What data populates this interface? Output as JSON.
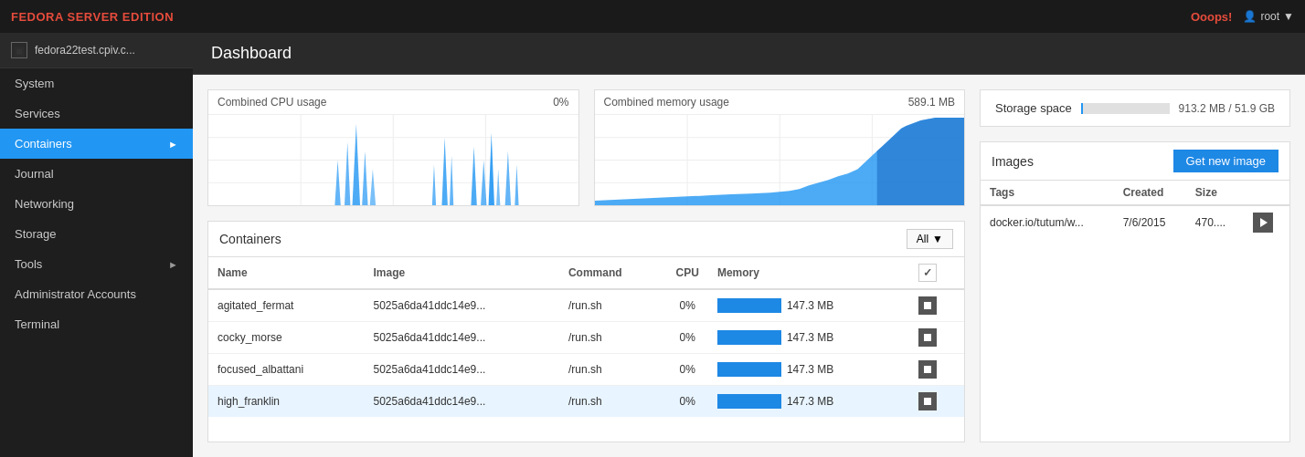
{
  "topbar": {
    "brand_prefix": "FEDORA ",
    "brand_suffix": "SERVER EDITION",
    "ooops": "Ooops!",
    "user": "root"
  },
  "sidebar": {
    "host": "fedora22test.cpiv.c...",
    "items": [
      {
        "label": "System",
        "active": false
      },
      {
        "label": "Services",
        "active": false
      },
      {
        "label": "Containers",
        "active": true,
        "hasChevron": true
      },
      {
        "label": "Journal",
        "active": false
      },
      {
        "label": "Networking",
        "active": false
      },
      {
        "label": "Storage",
        "active": false
      },
      {
        "label": "Tools",
        "active": false,
        "hasChevron": true
      },
      {
        "label": "Administrator Accounts",
        "active": false
      },
      {
        "label": "Terminal",
        "active": false
      }
    ]
  },
  "dashboard": {
    "title": "Dashboard"
  },
  "cpu_chart": {
    "label": "Combined CPU usage",
    "value": "0%"
  },
  "memory_chart": {
    "label": "Combined memory usage",
    "value": "589.1 MB"
  },
  "containers": {
    "title": "Containers",
    "filter": "All",
    "columns": [
      "Name",
      "Image",
      "Command",
      "CPU",
      "Memory",
      ""
    ],
    "rows": [
      {
        "name": "agitated_fermat",
        "image": "5025a6da41ddc14e9...",
        "command": "/run.sh",
        "cpu": "0%",
        "memory": "147.3 MB",
        "highlighted": false
      },
      {
        "name": "cocky_morse",
        "image": "5025a6da41ddc14e9...",
        "command": "/run.sh",
        "cpu": "0%",
        "memory": "147.3 MB",
        "highlighted": false
      },
      {
        "name": "focused_albattani",
        "image": "5025a6da41ddc14e9...",
        "command": "/run.sh",
        "cpu": "0%",
        "memory": "147.3 MB",
        "highlighted": false
      },
      {
        "name": "high_franklin",
        "image": "5025a6da41ddc14e9...",
        "command": "/run.sh",
        "cpu": "0%",
        "memory": "147.3 MB",
        "highlighted": true
      }
    ]
  },
  "storage": {
    "label": "Storage space",
    "value": "913.2 MB / 51.9 GB",
    "percent": 2
  },
  "images": {
    "title": "Images",
    "button": "Get new image",
    "columns": [
      "Tags",
      "Created",
      "Size"
    ],
    "rows": [
      {
        "tags": "docker.io/tutum/w...",
        "created": "7/6/2015",
        "size": "470...."
      }
    ]
  }
}
